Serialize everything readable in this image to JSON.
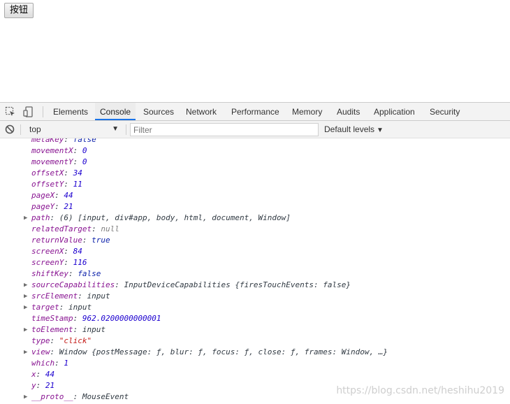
{
  "page": {
    "button_label": "按钮"
  },
  "devtools": {
    "tabs": [
      "Elements",
      "Console",
      "Sources",
      "Network",
      "Performance",
      "Memory",
      "Audits",
      "Application",
      "Security"
    ],
    "active_tab": "Console",
    "toolbar": {
      "context": "top",
      "filter_placeholder": "Filter",
      "filter_value": "",
      "levels": "Default levels"
    }
  },
  "console_lines": [
    {
      "key": "metaKey",
      "value": "false",
      "vtype": "bool",
      "expandable": false
    },
    {
      "key": "movementX",
      "value": "0",
      "vtype": "num",
      "expandable": false
    },
    {
      "key": "movementY",
      "value": "0",
      "vtype": "num",
      "expandable": false
    },
    {
      "key": "offsetX",
      "value": "34",
      "vtype": "num",
      "expandable": false
    },
    {
      "key": "offsetY",
      "value": "11",
      "vtype": "num",
      "expandable": false
    },
    {
      "key": "pageX",
      "value": "44",
      "vtype": "num",
      "expandable": false
    },
    {
      "key": "pageY",
      "value": "21",
      "vtype": "num",
      "expandable": false
    },
    {
      "key": "path",
      "value": "(6) [input, div#app, body, html, document, Window]",
      "vtype": "obj",
      "expandable": true
    },
    {
      "key": "relatedTarget",
      "value": "null",
      "vtype": "nul",
      "expandable": false
    },
    {
      "key": "returnValue",
      "value": "true",
      "vtype": "bool",
      "expandable": false
    },
    {
      "key": "screenX",
      "value": "84",
      "vtype": "num",
      "expandable": false
    },
    {
      "key": "screenY",
      "value": "116",
      "vtype": "num",
      "expandable": false
    },
    {
      "key": "shiftKey",
      "value": "false",
      "vtype": "bool",
      "expandable": false
    },
    {
      "key": "sourceCapabilities",
      "value": "InputDeviceCapabilities {firesTouchEvents: false}",
      "vtype": "obj",
      "expandable": true
    },
    {
      "key": "srcElement",
      "value": "input",
      "vtype": "obj",
      "expandable": true
    },
    {
      "key": "target",
      "value": "input",
      "vtype": "obj",
      "expandable": true
    },
    {
      "key": "timeStamp",
      "value": "962.0200000000001",
      "vtype": "num",
      "expandable": false
    },
    {
      "key": "toElement",
      "value": "input",
      "vtype": "obj",
      "expandable": true
    },
    {
      "key": "type",
      "value": "\"click\"",
      "vtype": "str",
      "expandable": false
    },
    {
      "key": "view",
      "value": "Window {postMessage: ƒ, blur: ƒ, focus: ƒ, close: ƒ, frames: Window, …}",
      "vtype": "obj",
      "expandable": true
    },
    {
      "key": "which",
      "value": "1",
      "vtype": "num",
      "expandable": false
    },
    {
      "key": "x",
      "value": "44",
      "vtype": "num",
      "expandable": false
    },
    {
      "key": "y",
      "value": "21",
      "vtype": "num",
      "expandable": false
    },
    {
      "key": "__proto__",
      "value": "MouseEvent",
      "vtype": "obj",
      "expandable": true
    }
  ],
  "watermark": "https://blog.csdn.net/heshihu2019"
}
